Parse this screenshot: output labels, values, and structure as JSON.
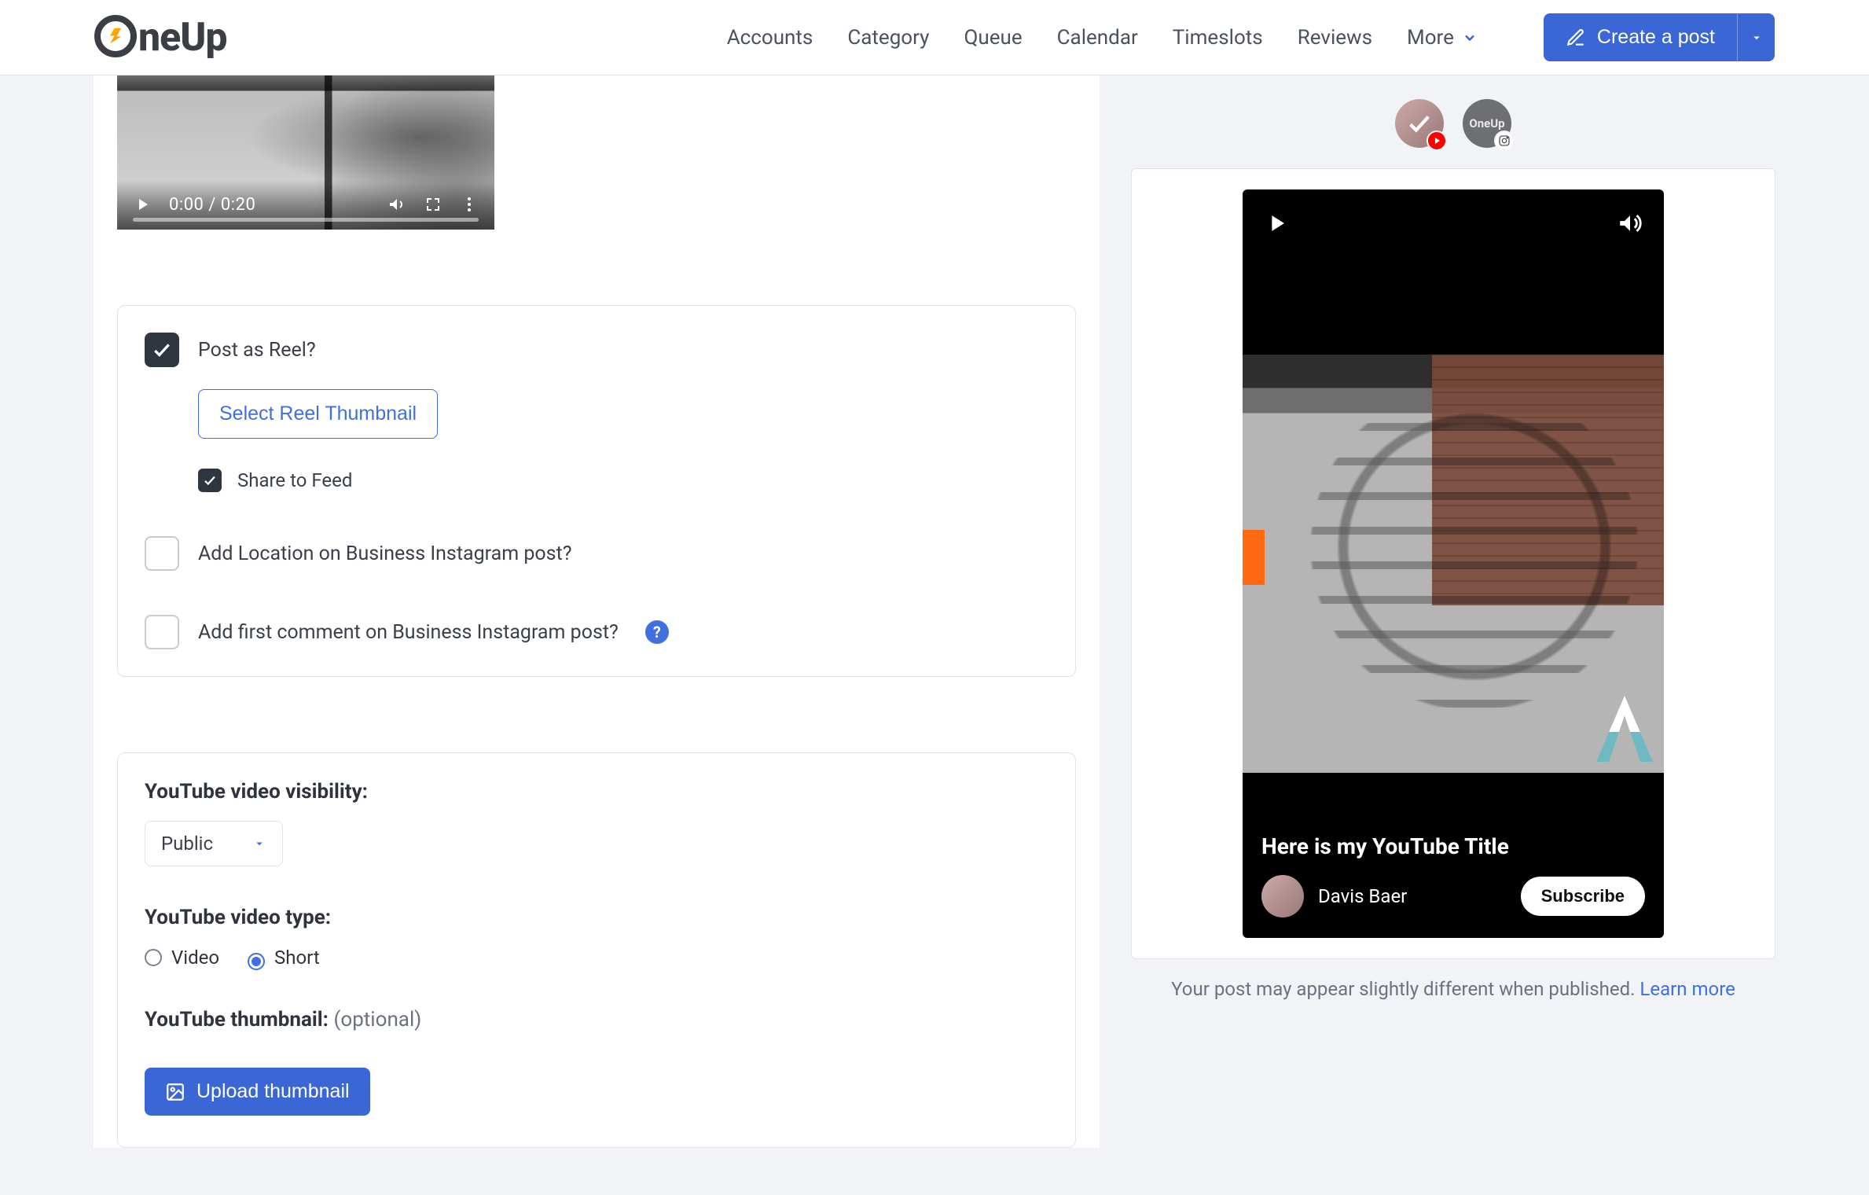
{
  "header": {
    "brand_prefix": "ne",
    "brand_suffix": "Up",
    "nav": {
      "accounts": "Accounts",
      "category": "Category",
      "queue": "Queue",
      "calendar": "Calendar",
      "timeslots": "Timeslots",
      "reviews": "Reviews",
      "more": "More"
    },
    "create_label": "Create a post"
  },
  "video": {
    "time": "0:00 / 0:20"
  },
  "instagram": {
    "post_as_reel": "Post as Reel?",
    "select_thumb_btn": "Select Reel Thumbnail",
    "share_to_feed": "Share to Feed",
    "add_location": "Add Location on Business Instagram post?",
    "add_first_comment": "Add first comment on Business Instagram post?"
  },
  "youtube": {
    "visibility_label": "YouTube video visibility:",
    "visibility_value": "Public",
    "video_type_label": "YouTube video type:",
    "type_video": "Video",
    "type_short": "Short",
    "thumb_label": "YouTube thumbnail:",
    "thumb_optional": " (optional)",
    "upload_btn": "Upload thumbnail"
  },
  "preview": {
    "brand_badge": "OneUp",
    "title": "Here is my YouTube Title",
    "author": "Davis Baer",
    "subscribe": "Subscribe",
    "note": "Your post may appear slightly different when published. ",
    "learn_more": "Learn more"
  }
}
